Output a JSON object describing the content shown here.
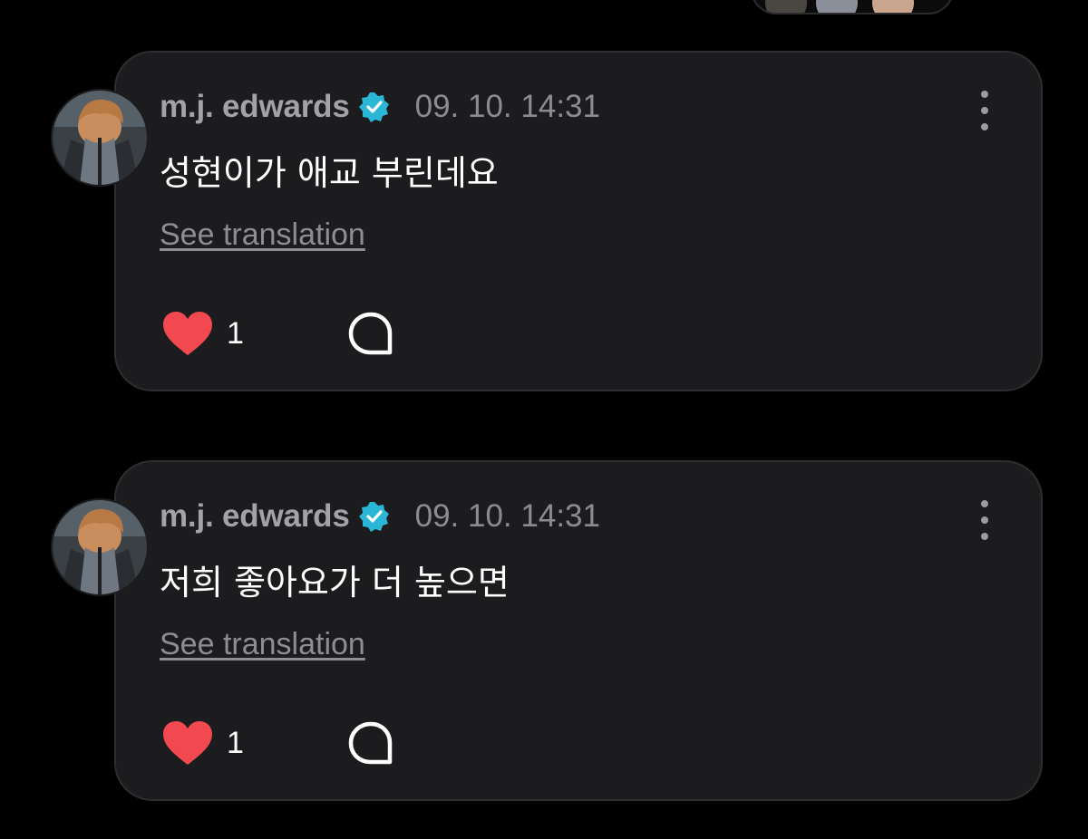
{
  "colors": {
    "background": "#000000",
    "card": "#1c1c1e",
    "card_border": "#2e2e30",
    "username": "#a3a3a6",
    "timestamp": "#8c8c90",
    "verified_badge": "#2ab6d6",
    "heart": "#f2484f",
    "link": "#8e8e92",
    "text": "#ffffff"
  },
  "reactors": {
    "icons": [
      "avatar",
      "avatar",
      "avatar"
    ]
  },
  "posts": [
    {
      "author": "m.j. edwards",
      "verified_icon": "verified-badge-icon",
      "timestamp": "09. 10. 14:31",
      "text": "성현이가 애교 부린데요",
      "translate_label": "See translation",
      "like_count": "1",
      "like_icon": "heart-icon",
      "comment_icon": "comment-bubble-icon",
      "menu_icon": "more-vertical-icon"
    },
    {
      "author": "m.j. edwards",
      "verified_icon": "verified-badge-icon",
      "timestamp": "09. 10. 14:31",
      "text": "저희 좋아요가 더 높으면",
      "translate_label": "See translation",
      "like_count": "1",
      "like_icon": "heart-icon",
      "comment_icon": "comment-bubble-icon",
      "menu_icon": "more-vertical-icon"
    }
  ]
}
